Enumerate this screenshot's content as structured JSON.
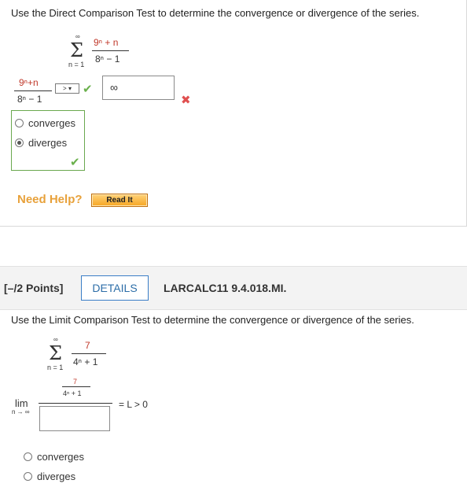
{
  "q1": {
    "prompt": "Use the Direct Comparison Test to determine the convergence or divergence of the series.",
    "series": {
      "sigma": "Σ",
      "upper": "∞",
      "lower": "n = 1",
      "numerator": "9ⁿ + n",
      "denominator": "8ⁿ − 1"
    },
    "comparison_fraction": {
      "numerator": "9ⁿ+n",
      "denominator": "8ⁿ − 1"
    },
    "comparison_select": {
      "selected": ">"
    },
    "comparison_value": "∞",
    "select_status": "correct",
    "value_status": "incorrect",
    "options": [
      {
        "label": "converges",
        "selected": false
      },
      {
        "label": "diverges",
        "selected": true
      }
    ],
    "options_status": "correct",
    "need_help": "Need Help?",
    "read_it": "Read It"
  },
  "q2": {
    "points": "[–/2 Points]",
    "details_label": "DETAILS",
    "ref": "LARCALC11 9.4.018.MI.",
    "prompt": "Use the Limit Comparison Test to determine the convergence or divergence of the series.",
    "series": {
      "sigma": "Σ",
      "upper": "∞",
      "lower": "n = 1",
      "numerator": "7",
      "denominator": "4ⁿ + 1"
    },
    "limit": {
      "lim": "lim",
      "sub": "n → ∞",
      "inner_numerator": "7",
      "inner_denominator": "4ⁿ + 1",
      "result": "= L > 0",
      "denominator_value": ""
    },
    "options": [
      {
        "label": "converges",
        "selected": false
      },
      {
        "label": "diverges",
        "selected": false
      }
    ]
  },
  "colors": {
    "accent_blue": "#2d6ea8",
    "correct_green": "#6ab04c",
    "wrong_red": "#e05050",
    "help_orange": "#e8a13a"
  }
}
